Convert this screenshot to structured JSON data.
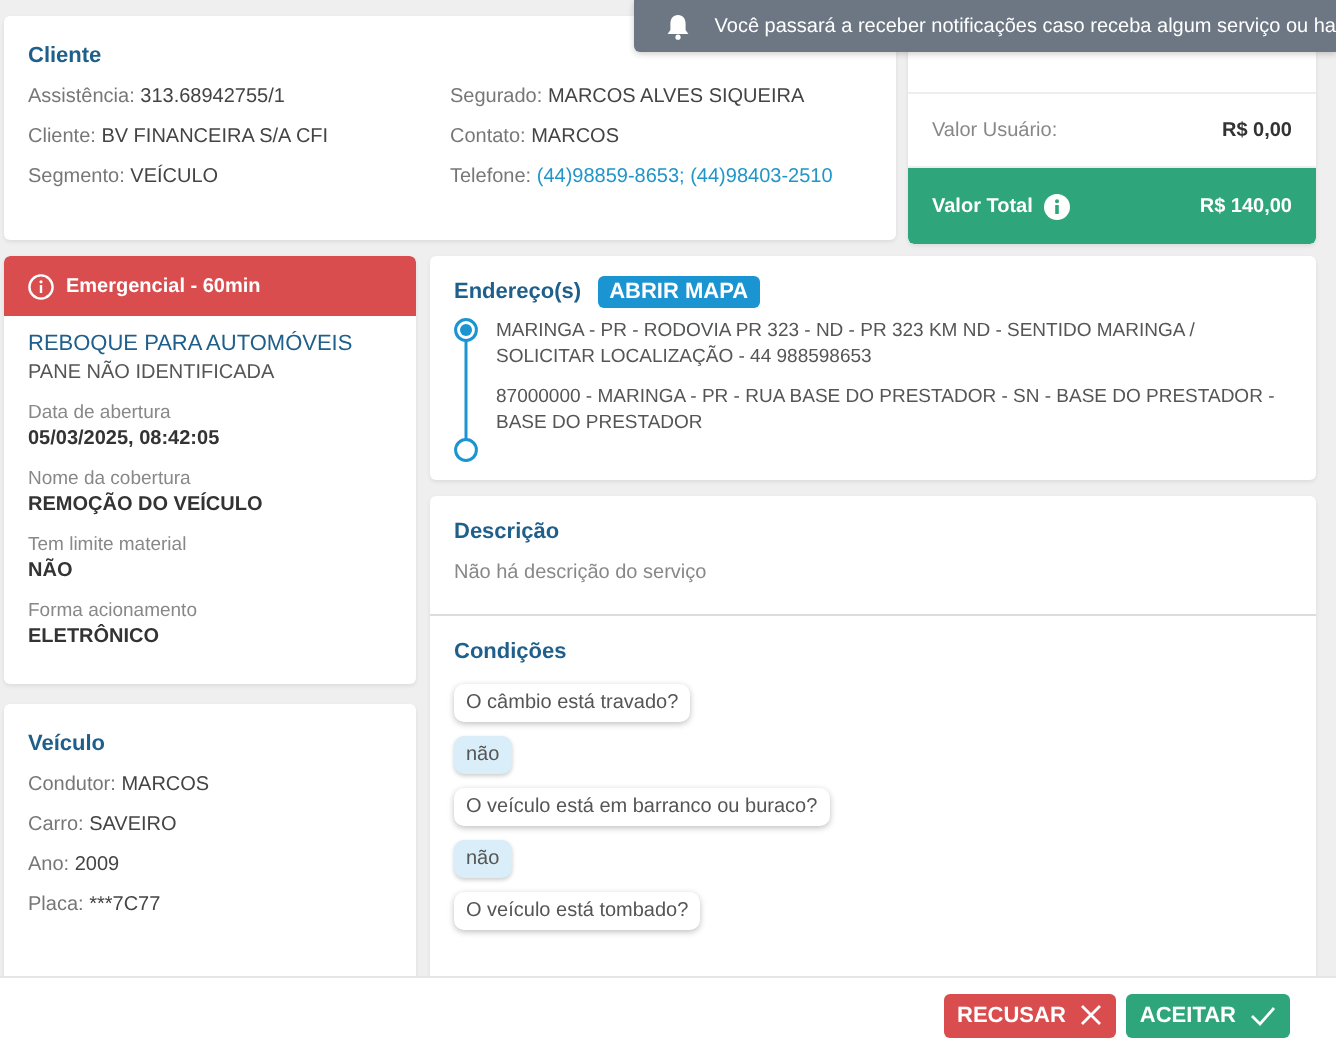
{
  "toast": {
    "text": "Você passará a receber notificações caso receba algum serviço ou ha"
  },
  "client": {
    "title": "Cliente",
    "left": [
      {
        "label": "Assistência:",
        "value": "313.68942755/1",
        "link": false
      },
      {
        "label": "Cliente:",
        "value": "BV FINANCEIRA S/A CFI",
        "link": false
      },
      {
        "label": "Segmento:",
        "value": "VEÍCULO",
        "link": false
      }
    ],
    "right": [
      {
        "label": "Segurado:",
        "value": "MARCOS ALVES SIQUEIRA",
        "link": false
      },
      {
        "label": "Contato:",
        "value": "MARCOS",
        "link": false
      },
      {
        "label": "Telefone:",
        "value": "(44)98859-8653; (44)98403-2510",
        "link": true
      }
    ]
  },
  "values": {
    "rows": [
      {
        "label": "Valor Usuário:",
        "value": "R$ 0,00"
      }
    ],
    "total": {
      "label": "Valor Total",
      "value": "R$ 140,00"
    }
  },
  "service": {
    "banner": "Emergencial - 60min",
    "title": "REBOQUE PARA AUTOMÓVEIS",
    "subtitle": "PANE NÃO IDENTIFICADA",
    "fields": [
      {
        "label": "Data de abertura",
        "value": "05/03/2025, 08:42:05"
      },
      {
        "label": "Nome da cobertura",
        "value": "REMOÇÃO DO VEÍCULO"
      },
      {
        "label": "Tem limite material",
        "value": "NÃO"
      },
      {
        "label": "Forma acionamento",
        "value": "ELETRÔNICO"
      }
    ]
  },
  "vehicle": {
    "title": "Veículo",
    "rows": [
      {
        "label": "Condutor:",
        "value": "MARCOS"
      },
      {
        "label": "Carro:",
        "value": "SAVEIRO"
      },
      {
        "label": "Ano:",
        "value": "2009"
      },
      {
        "label": "Placa:",
        "value": "***7C77"
      }
    ]
  },
  "addresses": {
    "title": "Endereço(s)",
    "map_button": "ABRIR MAPA",
    "items": [
      {
        "kind": "origin",
        "text": "MARINGA - PR - RODOVIA PR 323 - ND - PR 323 KM ND - SENTIDO MARINGA / SOLICITAR LOCALIZAÇÃO - 44 988598653"
      },
      {
        "kind": "destination",
        "text": "87000000 - MARINGA - PR - RUA BASE DO PRESTADOR - SN - BASE DO PRESTADOR - BASE DO PRESTADOR"
      }
    ]
  },
  "description": {
    "title": "Descrição",
    "text": "Não há descrição do serviço"
  },
  "conditions": {
    "title": "Condições",
    "items": [
      {
        "kind": "question",
        "text": "O câmbio está travado?"
      },
      {
        "kind": "answer",
        "text": "não"
      },
      {
        "kind": "question",
        "text": "O veículo está em barranco ou buraco?"
      },
      {
        "kind": "answer",
        "text": "não"
      },
      {
        "kind": "question",
        "text": "O veículo está tombado?"
      }
    ]
  },
  "footer": {
    "buttons": [
      {
        "kind": "reject",
        "label": "RECUSAR"
      },
      {
        "kind": "accept",
        "label": "ACEITAR"
      }
    ]
  }
}
